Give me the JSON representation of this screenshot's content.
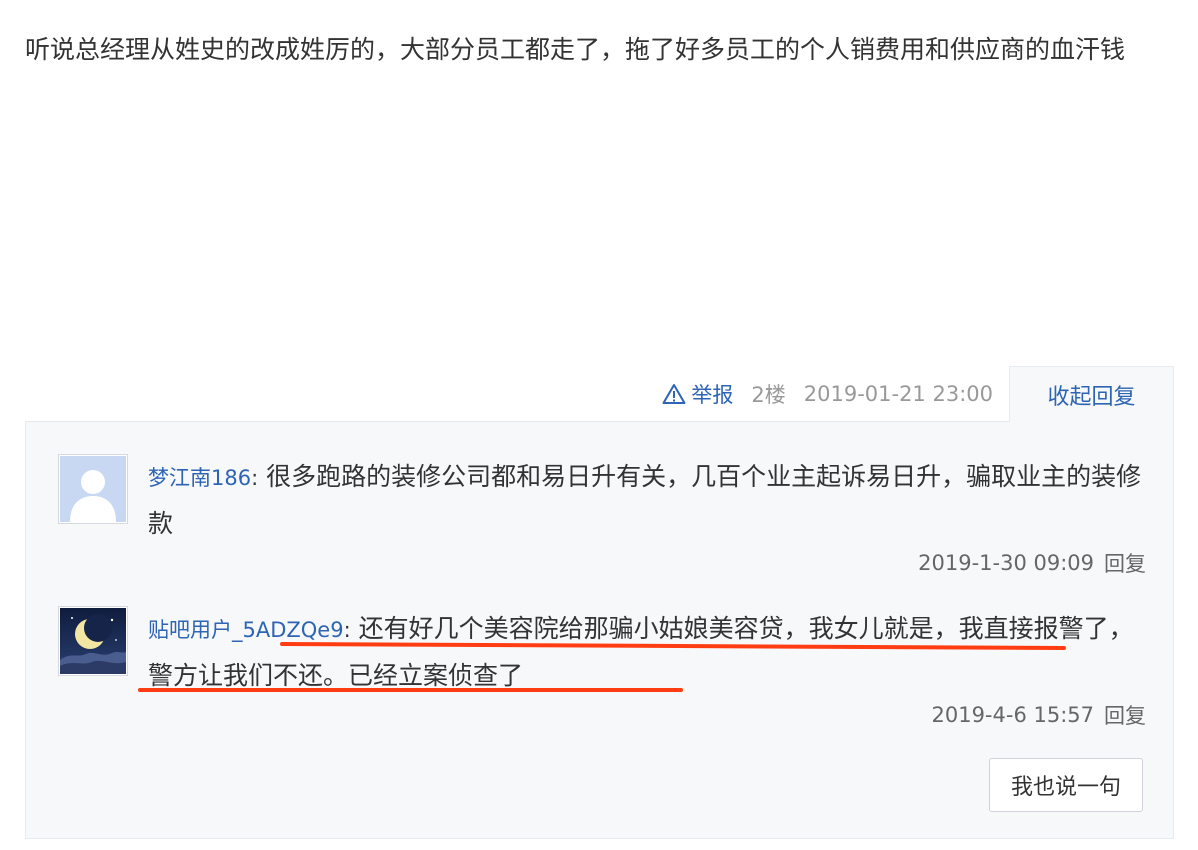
{
  "post": {
    "content": "听说总经理从姓史的改成姓厉的，大部分员工都走了，拖了好多员工的个人销费用和供应商的血汗钱"
  },
  "meta": {
    "report_label": "举报",
    "floor": "2楼",
    "time": "2019-01-21 23:00",
    "collapse_label": "收起回复"
  },
  "replies": [
    {
      "user": "梦江南186",
      "separator": ":",
      "text": " 很多跑路的装修公司都和易日升有关，几百个业主起诉易日升，骗取业主的装修款",
      "time": "2019-1-30 09:09",
      "reply_label": "回复",
      "avatar_icon": "default-user-avatar"
    },
    {
      "user": "贴吧用户_5ADZQe9",
      "separator": ":",
      "text": " 还有好几个美容院给那骗小姑娘美容贷，我女儿就是，我直接报警了，警方让我们不还。已经立案侦查了",
      "time": "2019-4-6 15:57",
      "reply_label": "回复",
      "avatar_icon": "crescent-moon-night-avatar"
    }
  ],
  "say_button_label": "我也说一句",
  "colors": {
    "link": "#2d64b3",
    "underline": "#ff3c12",
    "panel_bg": "#f7f8fa"
  }
}
